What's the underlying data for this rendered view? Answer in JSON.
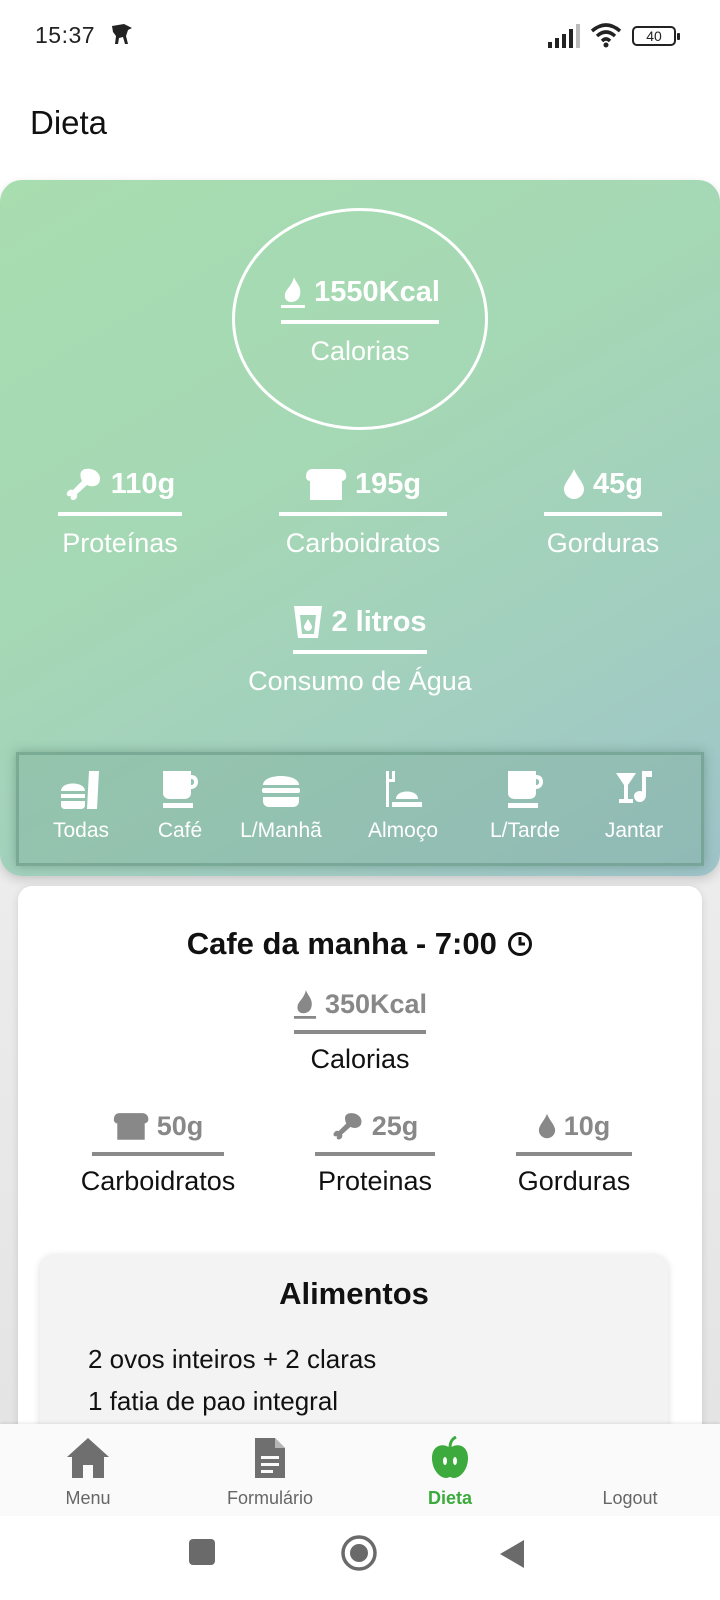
{
  "status_bar": {
    "time": "15:37",
    "battery": "40",
    "icons": [
      "dino-icon",
      "signal-icon",
      "wifi-icon",
      "battery-icon"
    ]
  },
  "app_bar": {
    "title": "Dieta"
  },
  "summary": {
    "calories": {
      "value": "1550Kcal",
      "label": "Calorias",
      "icon": "flame-icon"
    },
    "protein": {
      "value": "110g",
      "label": "Proteínas",
      "icon": "drumstick-icon"
    },
    "carbs": {
      "value": "195g",
      "label": "Carboidratos",
      "icon": "bread-icon"
    },
    "fat": {
      "value": "45g",
      "label": "Gorduras",
      "icon": "drop-icon"
    },
    "water": {
      "value": "2 litros",
      "label": "Consumo de Água",
      "icon": "glass-icon"
    }
  },
  "meal_filters": [
    {
      "label": "Todas",
      "icon": "fastfood-icon"
    },
    {
      "label": "Café",
      "icon": "cup-icon"
    },
    {
      "label": "L/Manhã",
      "icon": "burger-icon"
    },
    {
      "label": "Almoço",
      "icon": "dinner-icon"
    },
    {
      "label": "L/Tarde",
      "icon": "cup-icon"
    },
    {
      "label": "Jantar",
      "icon": "cocktail-music-icon"
    }
  ],
  "meal": {
    "title": "Cafe da manha - 7:00",
    "calories": {
      "value": "350Kcal",
      "label": "Calorias"
    },
    "carbs": {
      "value": "50g",
      "label": "Carboidratos"
    },
    "protein": {
      "value": "25g",
      "label": "Proteinas"
    },
    "fat": {
      "value": "10g",
      "label": "Gorduras"
    },
    "foods_title": "Alimentos",
    "foods": [
      "2 ovos inteiros + 2 claras",
      "1 fatia de pao integral"
    ]
  },
  "bottom_nav": [
    {
      "label": "Menu",
      "icon": "home-icon",
      "active": false
    },
    {
      "label": "Formulário",
      "icon": "document-icon",
      "active": false
    },
    {
      "label": "Dieta",
      "icon": "apple-icon",
      "active": true
    },
    {
      "label": "Logout",
      "icon": "logout-icon",
      "active": false
    }
  ],
  "colors": {
    "accent_green": "#3daa3d",
    "summary_gradient_start": "#a8ddb0",
    "summary_gradient_end": "#9ec3c9",
    "muted_icon": "#888888"
  }
}
